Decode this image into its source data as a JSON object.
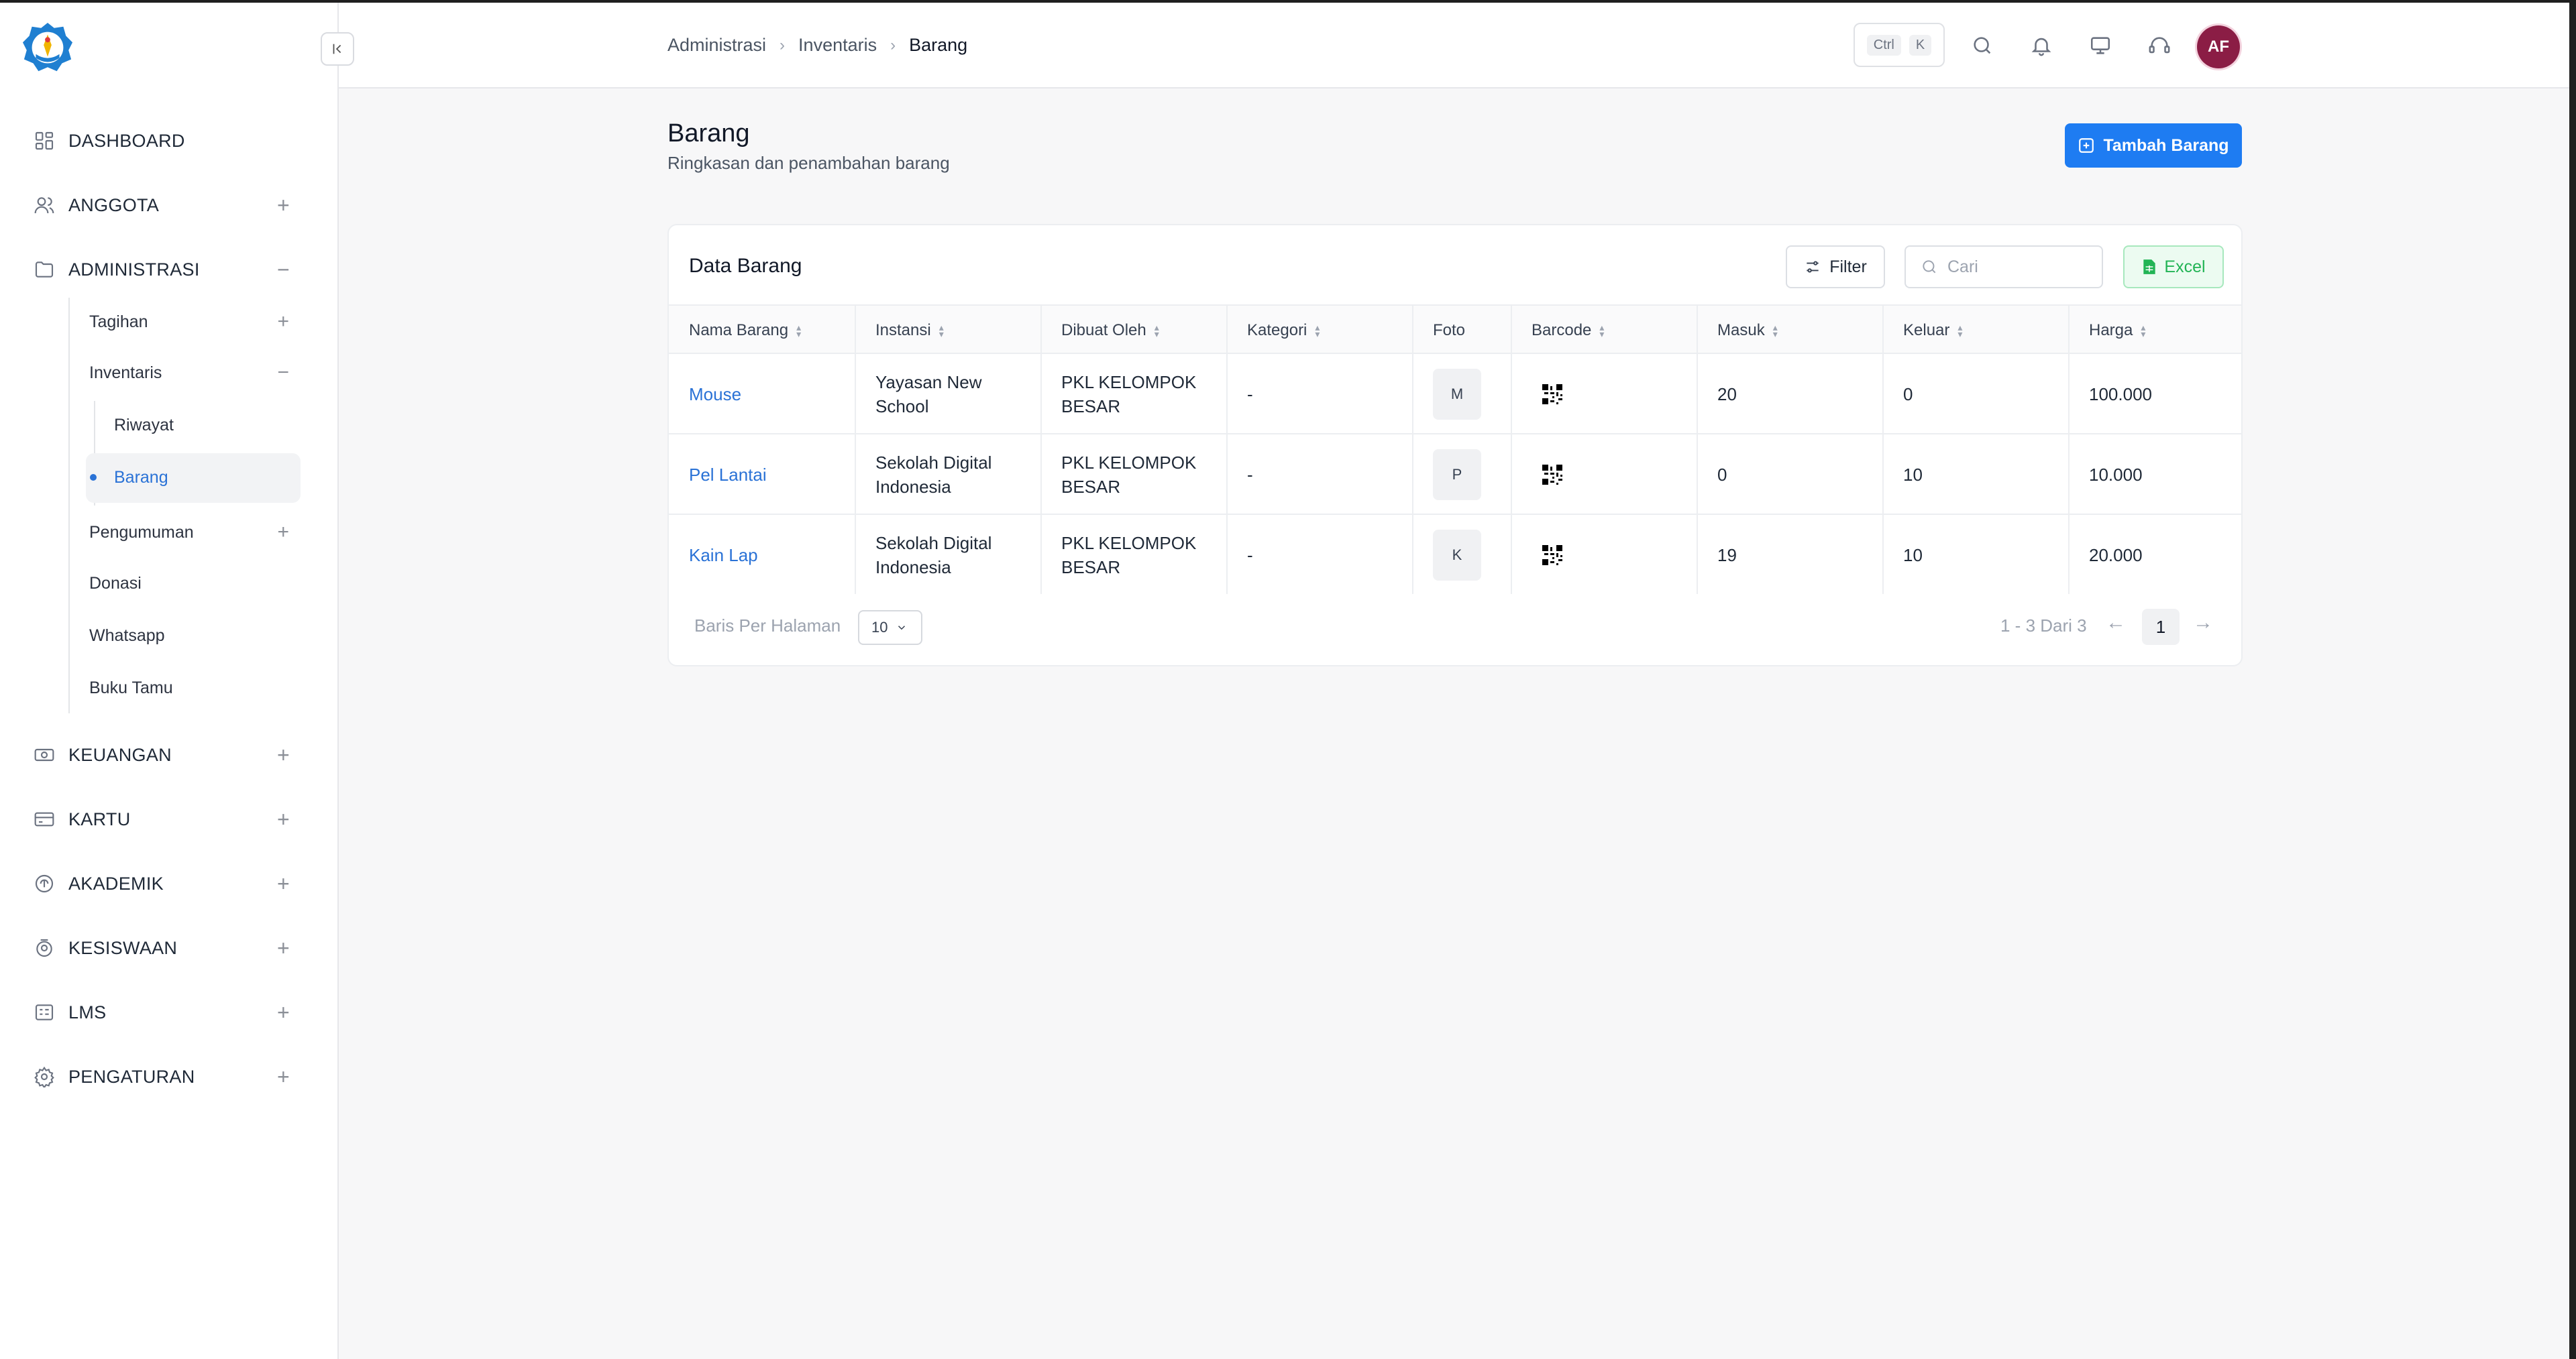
{
  "sidebar": {
    "items": [
      {
        "label": "DASHBOARD",
        "icon": "dashboard-icon",
        "toggle": ""
      },
      {
        "label": "ANGGOTA",
        "icon": "users-icon",
        "toggle": "+"
      },
      {
        "label": "ADMINISTRASI",
        "icon": "folder-icon",
        "toggle": "−"
      },
      {
        "label": "KEUANGAN",
        "icon": "money-icon",
        "toggle": "+"
      },
      {
        "label": "KARTU",
        "icon": "card-icon",
        "toggle": "+"
      },
      {
        "label": "AKADEMIK",
        "icon": "academic-icon",
        "toggle": "+"
      },
      {
        "label": "KESISWAAN",
        "icon": "student-icon",
        "toggle": "+"
      },
      {
        "label": "LMS",
        "icon": "lms-icon",
        "toggle": "+"
      },
      {
        "label": "PENGATURAN",
        "icon": "settings-icon",
        "toggle": "+"
      }
    ],
    "sub_items": [
      {
        "label": "Tagihan",
        "toggle": "+"
      },
      {
        "label": "Inventaris",
        "toggle": "−"
      },
      {
        "label": "Pengumuman",
        "toggle": "+"
      },
      {
        "label": "Donasi",
        "toggle": ""
      },
      {
        "label": "Whatsapp",
        "toggle": ""
      },
      {
        "label": "Buku Tamu",
        "toggle": ""
      }
    ],
    "sub_sub_items": [
      {
        "label": "Riwayat"
      },
      {
        "label": "Barang"
      }
    ]
  },
  "breadcrumb": [
    "Administrasi",
    "Inventaris",
    "Barang"
  ],
  "topbar": {
    "kbd_ctrl": "Ctrl",
    "kbd_k": "K",
    "avatar": "AF"
  },
  "page": {
    "title": "Barang",
    "subtitle": "Ringkasan dan penambahan barang",
    "add_button": "Tambah Barang"
  },
  "card": {
    "title": "Data Barang",
    "filter_label": "Filter",
    "search_placeholder": "Cari",
    "excel_label": "Excel"
  },
  "table": {
    "columns": [
      "Nama Barang",
      "Instansi",
      "Dibuat Oleh",
      "Kategori",
      "Foto",
      "Barcode",
      "Masuk",
      "Keluar",
      "Harga"
    ],
    "rows": [
      {
        "nama": "Mouse",
        "instansi_1": "Yayasan New",
        "instansi_2": "School",
        "dibuat_1": "PKL KELOMPOK",
        "dibuat_2": "BESAR",
        "kategori": "-",
        "foto": "M",
        "masuk": "20",
        "keluar": "0",
        "harga": "100.000"
      },
      {
        "nama": "Pel Lantai",
        "instansi_1": "Sekolah Digital",
        "instansi_2": "Indonesia",
        "dibuat_1": "PKL KELOMPOK",
        "dibuat_2": "BESAR",
        "kategori": "-",
        "foto": "P",
        "masuk": "0",
        "keluar": "10",
        "harga": "10.000"
      },
      {
        "nama": "Kain Lap",
        "instansi_1": "Sekolah Digital",
        "instansi_2": "Indonesia",
        "dibuat_1": "PKL KELOMPOK",
        "dibuat_2": "BESAR",
        "kategori": "-",
        "foto": "K",
        "masuk": "19",
        "keluar": "10",
        "harga": "20.000"
      }
    ]
  },
  "pagination": {
    "rows_per_page_label": "Baris Per Halaman",
    "rows_per_page": "10",
    "info": "1 - 3 Dari 3",
    "current": "1",
    "prev": "←",
    "next": "→"
  },
  "colors": {
    "accent": "#1e7cf2",
    "link": "#2a72d6",
    "excel": "#22b455",
    "avatar": "#8b1d45"
  }
}
